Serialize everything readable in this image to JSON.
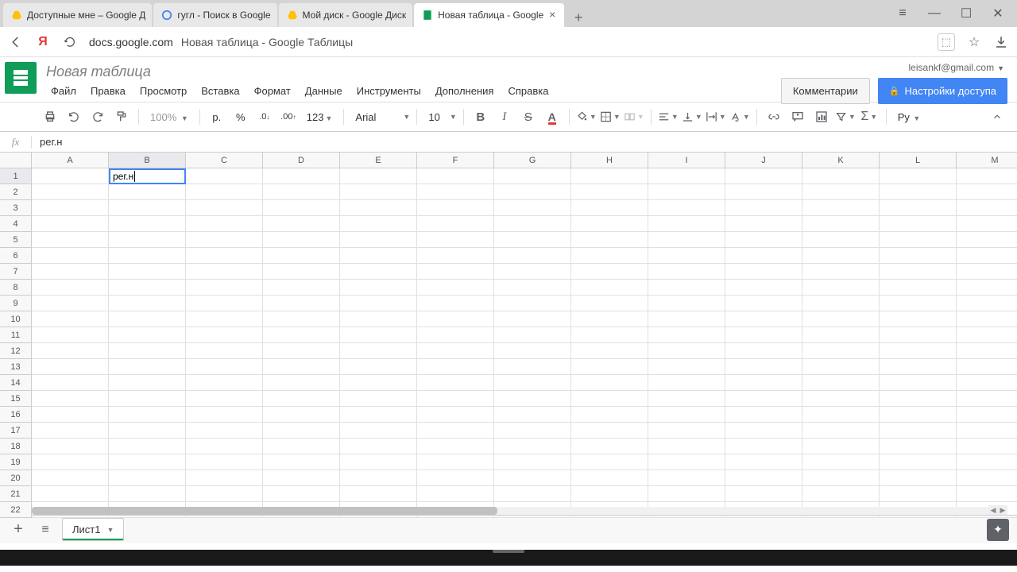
{
  "browser": {
    "tabs": [
      {
        "title": "Доступные мне – Google Д",
        "icon": "drive"
      },
      {
        "title": "гугл - Поиск в Google",
        "icon": "google"
      },
      {
        "title": "Мой диск - Google Диск",
        "icon": "drive"
      },
      {
        "title": "Новая таблица - Google",
        "icon": "sheets",
        "active": true
      }
    ],
    "url_domain": "docs.google.com",
    "url_title": "Новая таблица - Google Таблицы"
  },
  "header": {
    "doc_title": "Новая таблица",
    "user_email": "leisankf@gmail.com",
    "comments_label": "Комментарии",
    "share_label": "Настройки доступа"
  },
  "menu": {
    "items": [
      "Файл",
      "Правка",
      "Просмотр",
      "Вставка",
      "Формат",
      "Данные",
      "Инструменты",
      "Дополнения",
      "Справка"
    ]
  },
  "toolbar": {
    "zoom": "100%",
    "currency": "р.",
    "percent": "%",
    "dec_minus": ".0",
    "dec_plus": ".00",
    "num_format": "123",
    "font": "Arial",
    "font_size": "10",
    "script_lang": "Ру"
  },
  "formula": {
    "fx": "fx",
    "value": "рег.н"
  },
  "grid": {
    "columns": [
      "A",
      "B",
      "C",
      "D",
      "E",
      "F",
      "G",
      "H",
      "I",
      "J",
      "K",
      "L",
      "M"
    ],
    "rows": 22,
    "active_col": "B",
    "active_row": 1,
    "active_value": "рег.н"
  },
  "sheets": {
    "tab_name": "Лист1"
  }
}
